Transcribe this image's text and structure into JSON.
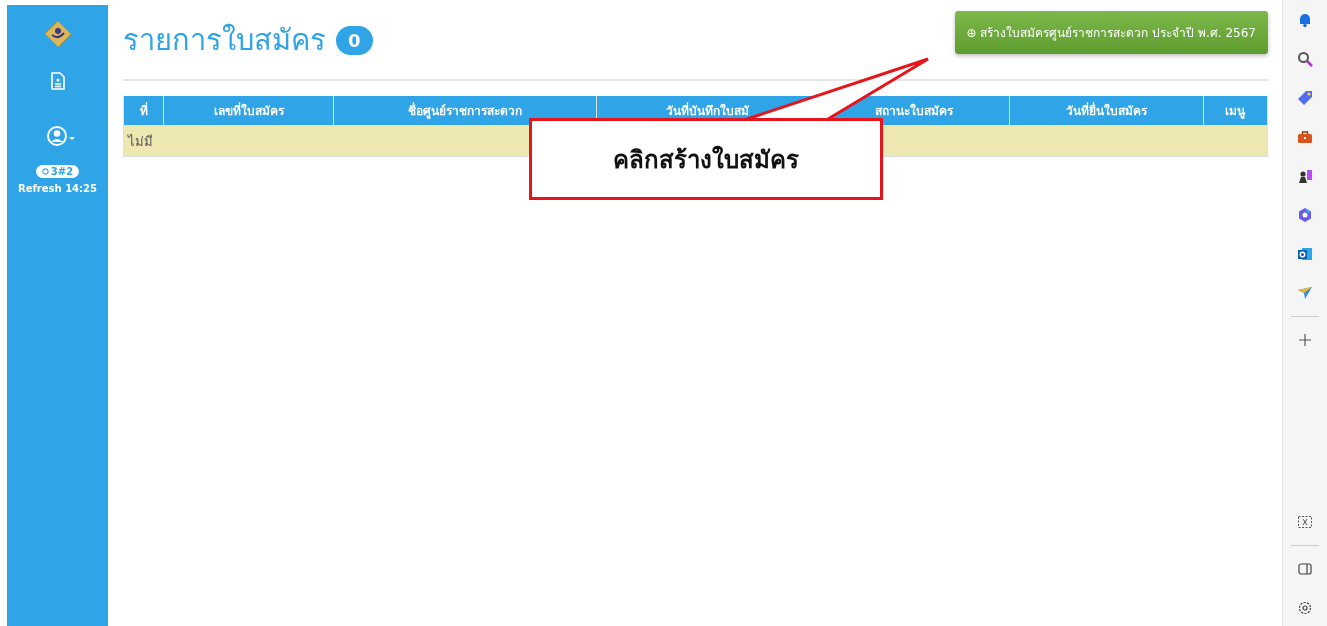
{
  "sidebar": {
    "badge": "3#2",
    "refresh": "Refresh 14:25"
  },
  "page": {
    "title": "รายการใบสมัคร",
    "count": "0",
    "create_button": "⊕ สร้างใบสมัครศูนย์ราชการสะดวก ประจำปี พ.ศ. 2567"
  },
  "table": {
    "columns": [
      "ที่",
      "เลขที่ใบสมัคร",
      "ชื่อศูนย์ราชการสะดวก",
      "วันที่บันทึกใบสมั",
      "สถานะใบสมัคร",
      "วันที่ยื่นใบสมัคร",
      "เมนู"
    ],
    "empty_text": "ไม่มี"
  },
  "callout": {
    "text": "คลิกสร้างใบสมัคร"
  }
}
